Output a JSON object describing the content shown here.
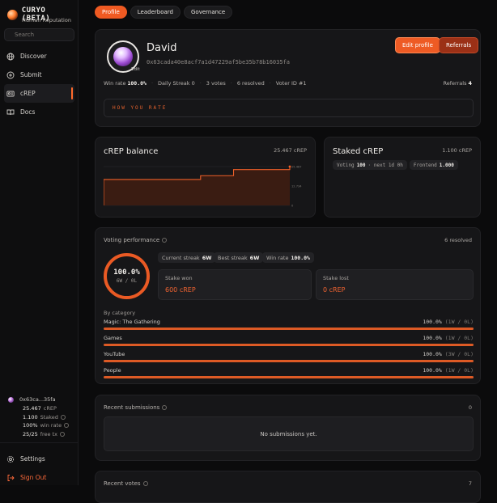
{
  "app": {
    "title": "CURYO (BETA)",
    "subtitle": "Human Reputation"
  },
  "search": {
    "placeholder": "Search"
  },
  "nav": [
    {
      "label": "Discover",
      "icon": "globe-icon"
    },
    {
      "label": "Submit",
      "icon": "plus-circle-icon"
    },
    {
      "label": "cREP",
      "icon": "id-card-icon",
      "active": true
    },
    {
      "label": "Docs",
      "icon": "book-icon"
    }
  ],
  "wallet": {
    "address": "0x63ca...35fa",
    "balance": "25.467",
    "balance_unit": "cREP",
    "staked": "1.100",
    "staked_label": "Staked",
    "win_rate": "100%",
    "win_rate_label": "win rate",
    "free_tx": "25/25",
    "free_tx_label": "free tx"
  },
  "side_bottom": {
    "settings": "Settings",
    "signout": "Sign Out"
  },
  "tabs": [
    {
      "label": "Profile",
      "active": true
    },
    {
      "label": "Leaderboard"
    },
    {
      "label": "Governance"
    }
  ],
  "profile": {
    "name": "David",
    "address": "0x63cada40e8acf7a1d47229af5be35b78b16035fa",
    "edit_avatar": "Edit",
    "edit_profile": "Edit profile",
    "referrals_btn": "Referrals",
    "stats": {
      "win_rate_label": "Win rate",
      "win_rate": "100.0%",
      "daily_streak": "Daily Streak 0",
      "votes": "3 votes",
      "resolved": "6 resolved",
      "voter_id": "Voter ID #1"
    },
    "referrals_label": "Referrals",
    "referrals_count": "4",
    "how_you_rate": "HOW YOU RATE"
  },
  "crep_balance": {
    "title": "cREP balance",
    "value": "25.467 cREP",
    "y_ticks": [
      "25.467",
      "12.734",
      "0"
    ]
  },
  "chart_data": {
    "type": "area",
    "series": [
      {
        "values": [
          17,
          17,
          17,
          17,
          17,
          17,
          17,
          17,
          17,
          17,
          17,
          17,
          17,
          17,
          17,
          17,
          17,
          17,
          17,
          17,
          17,
          17,
          17,
          17,
          17,
          17,
          17,
          17,
          17,
          17,
          17,
          17,
          17,
          17,
          17,
          17,
          17,
          17,
          17,
          17,
          17,
          17,
          17,
          17,
          17,
          17,
          17,
          17,
          17,
          17,
          19.5,
          19.5,
          19.5,
          19.5,
          19.5,
          19.5,
          19.5,
          19.5,
          19.5,
          19.5,
          19.5,
          19.5,
          19.5,
          19.5,
          19.5,
          19.5,
          19.5,
          23.5,
          23.5,
          23.5,
          23.5,
          23.5,
          23.5,
          23.5,
          23.5,
          23.5,
          23.5,
          23.5,
          23.5,
          23.5,
          23.5,
          23.5,
          23.5,
          23.5,
          23.5,
          23.5,
          23.5,
          23.5,
          23.5,
          23.5,
          23.5,
          23.5,
          23.5,
          23.5,
          23.5,
          23.5,
          25.467
        ]
      }
    ],
    "ylim": [
      0,
      25.467
    ]
  },
  "staked": {
    "title": "Staked cREP",
    "value": "1.100 cREP",
    "voting_label": "Voting",
    "voting_value": "100",
    "next": "· next 1d 0h",
    "frontend_label": "Frontend",
    "frontend_value": "1.000"
  },
  "voting": {
    "title": "Voting performance",
    "resolved": "6 resolved",
    "ring_pct": "100.0%",
    "ring_wl": "6W / 0L",
    "current_streak_label": "Current streak",
    "current_streak": "6W",
    "best_streak_label": "Best streak",
    "best_streak": "6W",
    "win_rate_label": "Win rate",
    "win_rate": "100.0%",
    "stake_won_label": "Stake won",
    "stake_won": "600 cREP",
    "stake_lost_label": "Stake lost",
    "stake_lost": "0 cREP",
    "by_category": "By category",
    "categories": [
      {
        "name": "Magic: The Gathering",
        "pct": "100.0%",
        "wl": "(1W / 0L)",
        "fill": 1
      },
      {
        "name": "Games",
        "pct": "100.0%",
        "wl": "(1W / 0L)",
        "fill": 1
      },
      {
        "name": "YouTube",
        "pct": "100.0%",
        "wl": "(3W / 0L)",
        "fill": 1
      },
      {
        "name": "People",
        "pct": "100.0%",
        "wl": "(1W / 0L)",
        "fill": 1
      }
    ]
  },
  "submissions": {
    "title": "Recent submissions",
    "count": "0",
    "empty": "No submissions yet."
  },
  "recent_votes": {
    "title": "Recent votes",
    "count": "7"
  }
}
